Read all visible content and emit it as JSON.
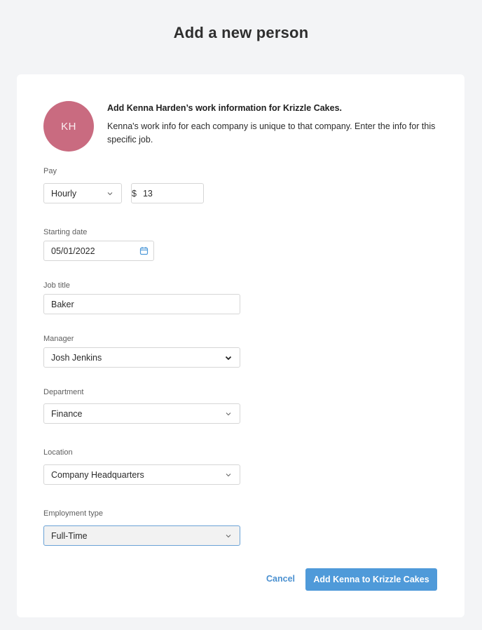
{
  "page": {
    "title": "Add a new person"
  },
  "person": {
    "initials": "KH",
    "avatar_color": "#c96b80"
  },
  "intro": {
    "title": "Add Kenna Harden’s work information for Krizzle Cakes.",
    "text": "Kenna's work info for each company is unique to that company. Enter the info for this specific job."
  },
  "form": {
    "pay": {
      "label": "Pay",
      "type_value": "Hourly",
      "currency_symbol": "$",
      "amount_value": "13"
    },
    "starting_date": {
      "label": "Starting date",
      "value": "05/01/2022"
    },
    "job_title": {
      "label": "Job title",
      "value": "Baker"
    },
    "manager": {
      "label": "Manager",
      "value": "Josh Jenkins"
    },
    "department": {
      "label": "Department",
      "value": "Finance"
    },
    "location": {
      "label": "Location",
      "value": "Company Headquarters"
    },
    "employment_type": {
      "label": "Employment type",
      "value": "Full-Time"
    }
  },
  "actions": {
    "cancel_label": "Cancel",
    "submit_label": "Add Kenna to Krizzle Cakes"
  },
  "colors": {
    "accent": "#4f9ad9",
    "link": "#4a90d0",
    "background": "#f3f4f6"
  }
}
